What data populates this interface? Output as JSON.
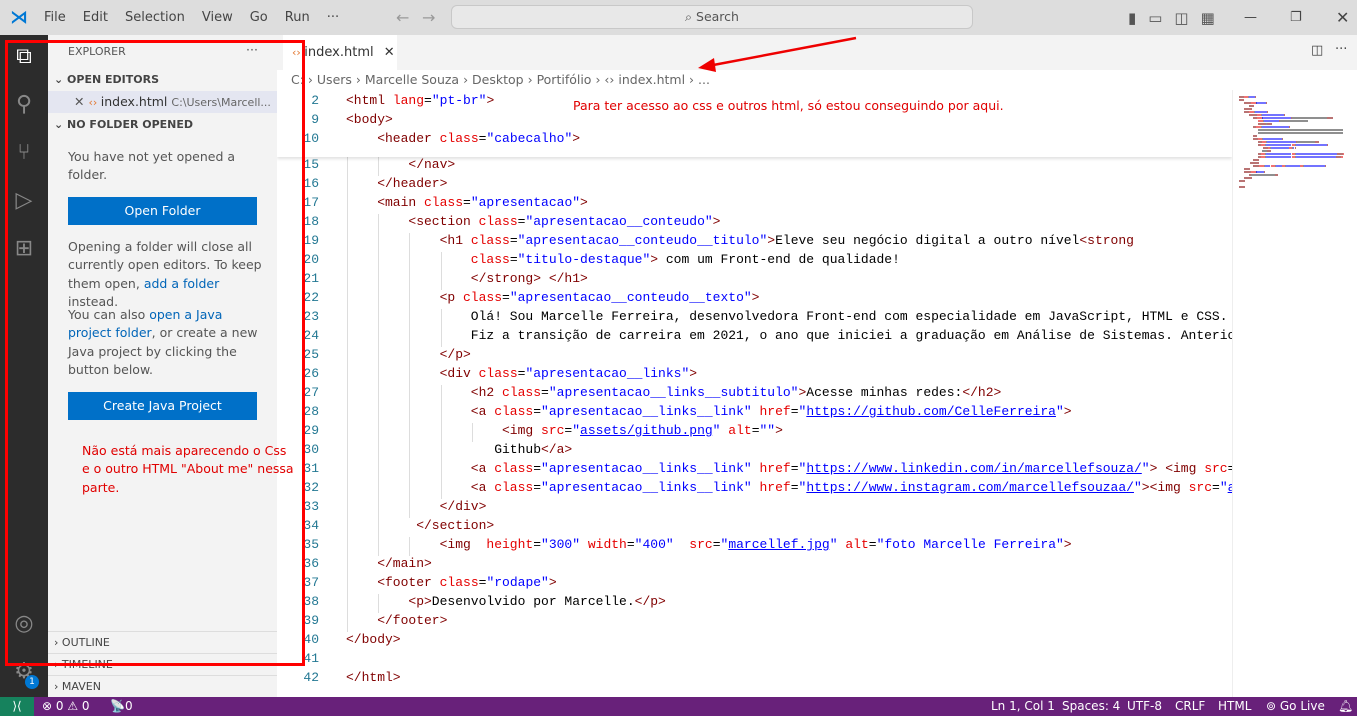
{
  "titlebar": {
    "menus": [
      "File",
      "Edit",
      "Selection",
      "View",
      "Go",
      "Run",
      "···"
    ],
    "search_placeholder": "Search"
  },
  "explorer": {
    "title": "EXPLORER",
    "more": "···",
    "open_editors": "OPEN EDITORS",
    "open_file": "index.html",
    "open_file_path": "C:\\Users\\Marcell...",
    "no_folder": "NO FOLDER OPENED",
    "p1": "You have not yet opened a folder.",
    "open_folder_btn": "Open Folder",
    "p2a": "Opening a folder will close all currently open editors. To keep them open, ",
    "p2link": "add a folder",
    "p2b": " instead.",
    "p3a": "You can also ",
    "p3link": "open a Java project folder",
    "p3b": ", or create a new Java project by clicking the button below.",
    "java_btn": "Create Java Project",
    "outline": "OUTLINE",
    "timeline": "TIMELINE",
    "maven": "MAVEN"
  },
  "activity": {
    "badge": "1"
  },
  "tab": {
    "label": "index.html"
  },
  "breadcrumb": [
    "C:",
    "Users",
    "Marcelle Souza",
    "Desktop",
    "Portifólio",
    "index.html",
    "..."
  ],
  "annotations": {
    "top": "Para ter acesso ao css e outros html, só estou conseguindo por aqui.",
    "side": "Não está mais aparecendo o Css e o outro HTML \"About me\" nessa parte."
  },
  "colors": {
    "status": "#68217a",
    "accent": "#0070c8",
    "annotation": "#e00000"
  },
  "sticky": [
    {
      "n": "2",
      "i": 0,
      "t": [
        [
          "tag",
          "<html "
        ],
        [
          "attr",
          "lang"
        ],
        [
          "",
          "="
        ],
        [
          "str",
          "\"pt-br\""
        ],
        [
          "tag",
          ">"
        ]
      ]
    },
    {
      "n": "9",
      "i": 0,
      "t": [
        [
          "tag",
          "<body>"
        ]
      ]
    },
    {
      "n": "10",
      "i": 4,
      "t": [
        [
          "tag",
          "<header "
        ],
        [
          "attr",
          "class"
        ],
        [
          "",
          "="
        ],
        [
          "str",
          "\"cabecalho\""
        ],
        [
          "tag",
          ">"
        ]
      ]
    }
  ],
  "lines": [
    {
      "n": "15",
      "i": 8,
      "t": [
        [
          "tag",
          "</nav>"
        ]
      ]
    },
    {
      "n": "16",
      "i": 4,
      "t": [
        [
          "tag",
          "</header>"
        ]
      ]
    },
    {
      "n": "17",
      "i": 4,
      "t": [
        [
          "tag",
          "<main "
        ],
        [
          "attr",
          "class"
        ],
        [
          "",
          "="
        ],
        [
          "str",
          "\"apresentacao\""
        ],
        [
          "tag",
          ">"
        ]
      ]
    },
    {
      "n": "18",
      "i": 8,
      "t": [
        [
          "tag",
          "<section "
        ],
        [
          "attr",
          "class"
        ],
        [
          "",
          "="
        ],
        [
          "str",
          "\"apresentacao__conteudo\""
        ],
        [
          "tag",
          ">"
        ]
      ]
    },
    {
      "n": "19",
      "i": 12,
      "t": [
        [
          "tag",
          "<h1 "
        ],
        [
          "attr",
          "class"
        ],
        [
          "",
          "="
        ],
        [
          "str",
          "\"apresentacao__conteudo__titulo\""
        ],
        [
          "tag",
          ">"
        ],
        [
          "",
          "Eleve seu negócio digital a outro nível"
        ],
        [
          "tag",
          "<strong"
        ]
      ]
    },
    {
      "n": "20",
      "i": 16,
      "t": [
        [
          "attr",
          "class"
        ],
        [
          "",
          "="
        ],
        [
          "str",
          "\"titulo-destaque\""
        ],
        [
          "tag",
          ">"
        ],
        [
          "",
          " com um Front-end de qualidade!"
        ]
      ]
    },
    {
      "n": "21",
      "i": 16,
      "t": [
        [
          "tag",
          "</strong>"
        ],
        [
          "",
          " "
        ],
        [
          "tag",
          "</h1>"
        ]
      ]
    },
    {
      "n": "22",
      "i": 12,
      "t": [
        [
          "tag",
          "<p "
        ],
        [
          "attr",
          "class"
        ],
        [
          "",
          "="
        ],
        [
          "str",
          "\"apresentacao__conteudo__texto\""
        ],
        [
          "tag",
          ">"
        ]
      ]
    },
    {
      "n": "23",
      "i": 16,
      "t": [
        [
          "",
          "Olá! Sou Marcelle Ferreira, desenvolvedora Front-end com especialidade em JavaScript, HTML e CSS."
        ]
      ]
    },
    {
      "n": "24",
      "i": 16,
      "t": [
        [
          "",
          "Fiz a transição de carreira em 2021, o ano que iniciei a graduação em Análise de Sistemas. Anteriormente"
        ]
      ]
    },
    {
      "n": "25",
      "i": 12,
      "t": [
        [
          "tag",
          "</p>"
        ]
      ]
    },
    {
      "n": "26",
      "i": 12,
      "t": [
        [
          "tag",
          "<div "
        ],
        [
          "attr",
          "class"
        ],
        [
          "",
          "="
        ],
        [
          "str",
          "\"apresentacao__links\""
        ],
        [
          "tag",
          ">"
        ]
      ]
    },
    {
      "n": "27",
      "i": 16,
      "t": [
        [
          "tag",
          "<h2 "
        ],
        [
          "attr",
          "class"
        ],
        [
          "",
          "="
        ],
        [
          "str",
          "\"apresentacao__links__subtitulo\""
        ],
        [
          "tag",
          ">"
        ],
        [
          "",
          "Acesse minhas redes:"
        ],
        [
          "tag",
          "</h2>"
        ]
      ]
    },
    {
      "n": "28",
      "i": 16,
      "t": [
        [
          "tag",
          "<a "
        ],
        [
          "attr",
          "class"
        ],
        [
          "",
          "="
        ],
        [
          "str",
          "\"apresentacao__links__link\" "
        ],
        [
          "attr",
          "href"
        ],
        [
          "",
          "="
        ],
        [
          "str",
          "\""
        ],
        [
          "link",
          "https://github.com/CelleFerreira"
        ],
        [
          "str",
          "\""
        ],
        [
          "tag",
          ">"
        ]
      ]
    },
    {
      "n": "29",
      "i": 20,
      "t": [
        [
          "tag",
          "<img "
        ],
        [
          "attr",
          "src"
        ],
        [
          "",
          "="
        ],
        [
          "str",
          "\""
        ],
        [
          "link",
          "assets/github.png"
        ],
        [
          "str",
          "\" "
        ],
        [
          "attr",
          "alt"
        ],
        [
          "",
          "="
        ],
        [
          "str",
          "\"\""
        ],
        [
          "tag",
          ">"
        ]
      ]
    },
    {
      "n": "30",
      "i": 19,
      "t": [
        [
          "",
          "Github"
        ],
        [
          "tag",
          "</a>"
        ]
      ]
    },
    {
      "n": "31",
      "i": 16,
      "t": [
        [
          "tag",
          "<a "
        ],
        [
          "attr",
          "class"
        ],
        [
          "",
          "="
        ],
        [
          "str",
          "\"apresentacao__links__link\" "
        ],
        [
          "attr",
          "href"
        ],
        [
          "",
          "="
        ],
        [
          "str",
          "\""
        ],
        [
          "link",
          "https://www.linkedin.com/in/marcellefsouza/"
        ],
        [
          "str",
          "\""
        ],
        [
          "tag",
          "> <img "
        ],
        [
          "attr",
          "src"
        ],
        [
          "",
          "="
        ],
        [
          "str",
          "\"assets"
        ]
      ]
    },
    {
      "n": "32",
      "i": 16,
      "t": [
        [
          "tag",
          "<a "
        ],
        [
          "attr",
          "class"
        ],
        [
          "",
          "="
        ],
        [
          "str",
          "\"apresentacao__links__link\" "
        ],
        [
          "attr",
          "href"
        ],
        [
          "",
          "="
        ],
        [
          "str",
          "\""
        ],
        [
          "link",
          "https://www.instagram.com/marcellefsouzaa/"
        ],
        [
          "str",
          "\""
        ],
        [
          "tag",
          ">"
        ],
        [
          "tag",
          "<img "
        ],
        [
          "attr",
          "src"
        ],
        [
          "",
          "="
        ],
        [
          "str",
          "\""
        ],
        [
          "link",
          "assets"
        ]
      ]
    },
    {
      "n": "33",
      "i": 12,
      "t": [
        [
          "tag",
          "</div>"
        ]
      ]
    },
    {
      "n": "34",
      "i": 9,
      "t": [
        [
          "tag",
          "</section>"
        ]
      ]
    },
    {
      "n": "35",
      "i": 12,
      "t": [
        [
          "tag",
          "<img  "
        ],
        [
          "attr",
          "height"
        ],
        [
          "",
          "="
        ],
        [
          "str",
          "\"300\" "
        ],
        [
          "attr",
          "width"
        ],
        [
          "",
          "="
        ],
        [
          "str",
          "\"400\"  "
        ],
        [
          "attr",
          "src"
        ],
        [
          "",
          "="
        ],
        [
          "str",
          "\""
        ],
        [
          "link",
          "marcellef.jpg"
        ],
        [
          "str",
          "\" "
        ],
        [
          "attr",
          "alt"
        ],
        [
          "",
          "="
        ],
        [
          "str",
          "\"foto Marcelle Ferreira\""
        ],
        [
          "tag",
          ">"
        ]
      ]
    },
    {
      "n": "36",
      "i": 4,
      "t": [
        [
          "tag",
          "</main>"
        ]
      ]
    },
    {
      "n": "37",
      "i": 4,
      "t": [
        [
          "tag",
          "<footer "
        ],
        [
          "attr",
          "class"
        ],
        [
          "",
          "="
        ],
        [
          "str",
          "\"rodape\""
        ],
        [
          "tag",
          ">"
        ]
      ]
    },
    {
      "n": "38",
      "i": 8,
      "t": [
        [
          "tag",
          "<p>"
        ],
        [
          "",
          "Desenvolvido por Marcelle."
        ],
        [
          "tag",
          "</p>"
        ]
      ]
    },
    {
      "n": "39",
      "i": 4,
      "t": [
        [
          "tag",
          "</footer>"
        ]
      ]
    },
    {
      "n": "40",
      "i": 0,
      "t": [
        [
          "tag",
          "</body>"
        ]
      ]
    },
    {
      "n": "41",
      "i": 0,
      "t": []
    },
    {
      "n": "42",
      "i": 0,
      "t": [
        [
          "tag",
          "</html>"
        ]
      ]
    }
  ],
  "status": {
    "errors": "0",
    "warnings": "0",
    "ports": "0",
    "position": "Ln 1, Col 1",
    "spaces": "Spaces: 4",
    "encoding": "UTF-8",
    "eol": "CRLF",
    "language": "HTML",
    "golive": "Go Live"
  }
}
